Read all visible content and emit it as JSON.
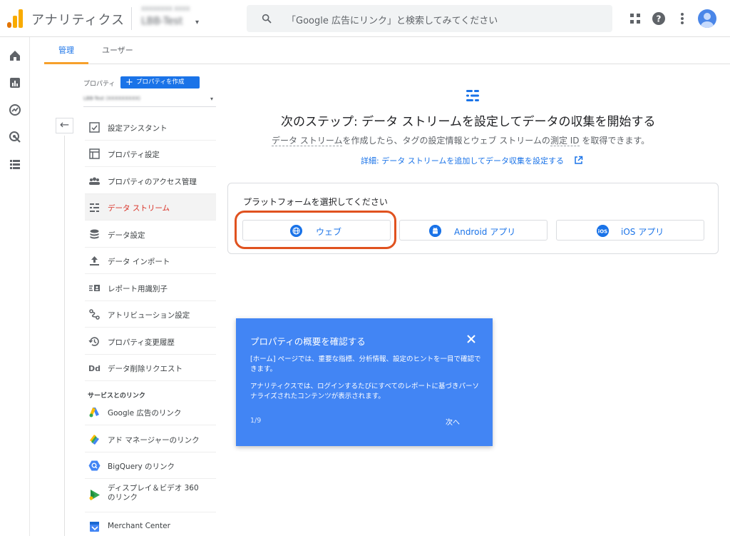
{
  "app": {
    "title": "アナリティクス",
    "account_line": "XXXXXXXX XXXX",
    "property_name": "LBB-Test"
  },
  "search": {
    "placeholder": "「Google 広告にリンク」と検索してみてください"
  },
  "tabs": [
    {
      "label": "管理",
      "active": true
    },
    {
      "label": "ユーザー",
      "active": false
    }
  ],
  "property_panel": {
    "label": "プロパティ",
    "create_button": "プロパティを作成",
    "selected_property": "LBB-Test (XXXXXXXXX)"
  },
  "nav": [
    {
      "label": "設定アシスタント",
      "icon": "checklist-icon"
    },
    {
      "label": "プロパティ設定",
      "icon": "property-settings-icon"
    },
    {
      "label": "プロパティのアクセス管理",
      "icon": "people-icon"
    },
    {
      "label": "データ ストリーム",
      "icon": "data-streams-icon",
      "active": true
    },
    {
      "label": "データ設定",
      "icon": "database-icon"
    },
    {
      "label": "データ インポート",
      "icon": "upload-icon"
    },
    {
      "label": "レポート用識別子",
      "icon": "identity-icon"
    },
    {
      "label": "アトリビューション設定",
      "icon": "attribution-icon"
    },
    {
      "label": "プロパティ変更履歴",
      "icon": "history-icon"
    },
    {
      "label": "データ削除リクエスト",
      "icon": "data-deletion-icon"
    }
  ],
  "links_section": {
    "heading": "サービスとのリンク",
    "items": [
      {
        "label": "Google 広告のリンク",
        "icon": "google-ads-icon"
      },
      {
        "label": "アド マネージャーのリンク",
        "icon": "ad-manager-icon"
      },
      {
        "label": "BigQuery のリンク",
        "icon": "bigquery-icon"
      },
      {
        "label_line1": "ディスプレイ＆ビデオ 360",
        "label_line2": "のリンク",
        "icon": "dv360-icon"
      },
      {
        "label": "Merchant Center",
        "icon": "merchant-center-icon"
      }
    ]
  },
  "main": {
    "title": "次のステップ: データ ストリームを設定してデータの収集を開始する",
    "desc_part1": "データ ストリーム",
    "desc_part2": "を作成したら、タグの設定情報とウェブ ストリームの",
    "desc_part3": "測定 ID",
    "desc_part4": " を取得できます。",
    "link": "詳細: データ ストリームを追加してデータ収集を設定する"
  },
  "platform": {
    "title": "プラットフォームを選択してください",
    "buttons": [
      {
        "label": "ウェブ",
        "icon": "globe-icon"
      },
      {
        "label": "Android アプリ",
        "icon": "android-icon"
      },
      {
        "label": "iOS アプリ",
        "icon": "ios-icon",
        "badge": "iOS"
      }
    ]
  },
  "tooltip": {
    "title": "プロパティの概要を確認する",
    "body1": "[ホーム] ページでは、重要な指標、分析情報、設定のヒントを一目で確認できます。",
    "body2": "アナリティクスでは、ログインするたびにすべてのレポートに基づきパーソナライズされたコンテンツが表示されます。",
    "counter": "1/9",
    "next": "次へ"
  },
  "colors": {
    "brand_orange": "#f9ab00",
    "accent_blue": "#1a73e8",
    "active_red": "#d93025",
    "tooltip_blue": "#4285f4",
    "highlight_ring": "#e0521f"
  }
}
